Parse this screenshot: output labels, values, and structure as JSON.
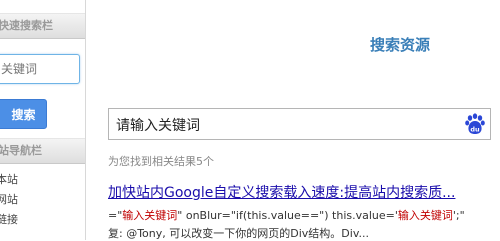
{
  "sidebar": {
    "quick_search_heading": "快速搜索栏",
    "search_placeholder": "关键词",
    "search_button": "搜索",
    "nav_heading": "站导航栏",
    "nav_items": [
      "本站",
      "网站",
      "链接"
    ]
  },
  "main": {
    "title": "搜索资源",
    "search_input_value": "请输入关键词",
    "result_count": "为您找到相关结果5个",
    "results": [
      {
        "title": "加快站内Google自定义搜索载入速度:提高站内搜索质...",
        "snippet_line1": {
          "a": "=\"",
          "b": "输入关键词",
          "c": "\" onBlur=\"if(this.value==\") this.value='",
          "d": "输入关键词",
          "e": "';\""
        },
        "snippet_line2": "复: @Tony, 可以改变一下你的网页的Div结构。Div..."
      }
    ]
  },
  "icons": {
    "baidu": "baidu-paw-icon"
  },
  "colors": {
    "accent_blue": "#3a7fb8",
    "button_blue": "#4c8fe6",
    "link_blue": "#1a0dab",
    "keyword_red": "#c00000",
    "baidu_blue": "#2b47d6"
  }
}
